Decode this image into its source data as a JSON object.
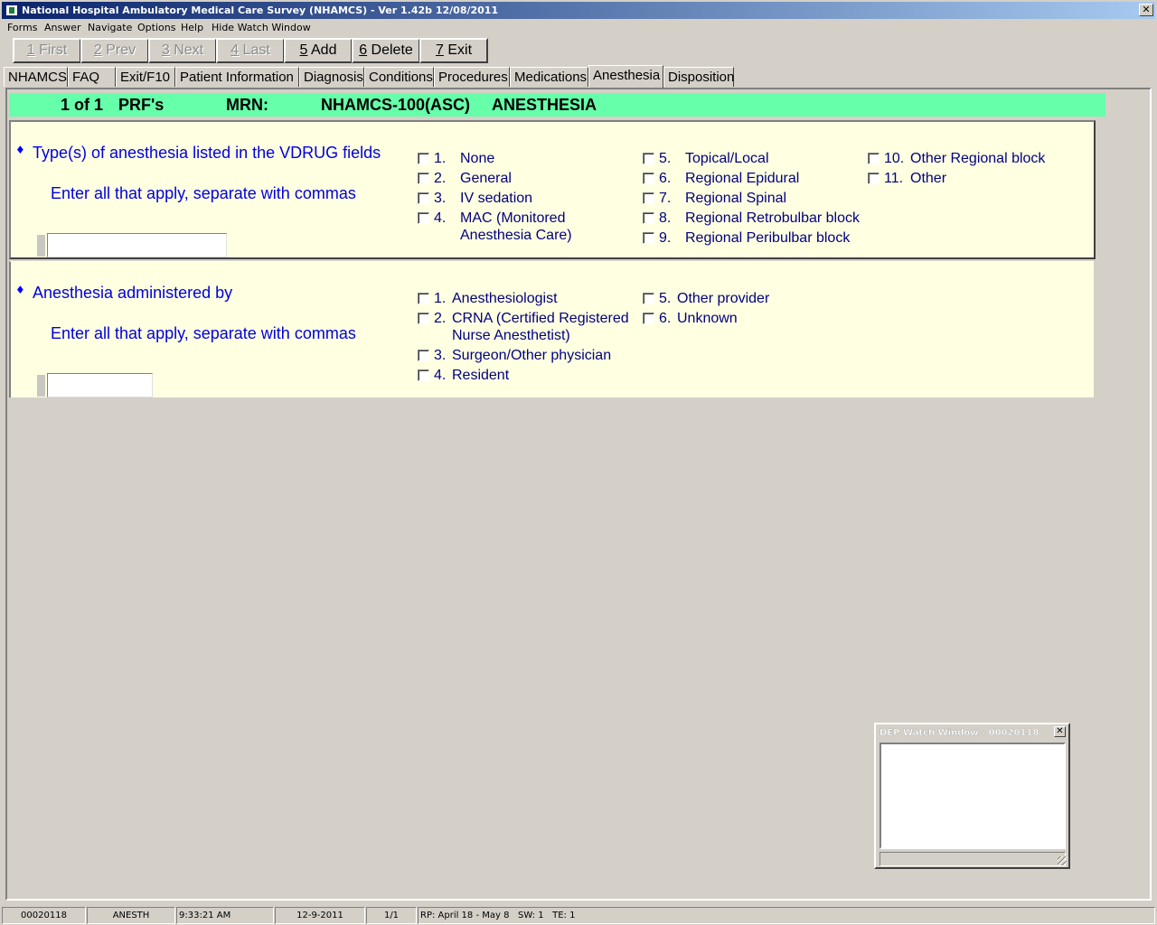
{
  "window": {
    "title": "National Hospital Ambulatory Medical Care Survey (NHAMCS) - Ver 1.42b 12/08/2011",
    "close_glyph": "✕"
  },
  "menu": [
    "Forms",
    "Answer",
    "Navigate",
    "Options",
    "Help",
    "Hide Watch Window"
  ],
  "toolbar": [
    {
      "key": "1",
      "label": " First",
      "enabled": false
    },
    {
      "key": "2",
      "label": " Prev",
      "enabled": false
    },
    {
      "key": "3",
      "label": " Next",
      "enabled": false
    },
    {
      "key": "4",
      "label": " Last",
      "enabled": false
    },
    {
      "key": "5",
      "label": " Add",
      "enabled": true
    },
    {
      "key": "6",
      "label": " Delete",
      "enabled": true
    },
    {
      "key": "7",
      "label": " Exit",
      "enabled": true
    }
  ],
  "tabs": [
    "NHAMCS",
    "FAQ",
    "Exit/F10",
    "Patient Information",
    "Diagnosis",
    "Conditions",
    "Procedures",
    "Medications",
    "Anesthesia",
    "Disposition"
  ],
  "active_tab": "Anesthesia",
  "header": {
    "record": "1 of 1",
    "prf": "PRF's",
    "mrn_label": "MRN:",
    "form": "NHAMCS-100(ASC)",
    "section": "ANESTHESIA",
    "color": "#66ffaa"
  },
  "question1": {
    "bullet": "♦",
    "text": "Type(s) of anesthesia listed in the VDRUG fields",
    "instruction": "Enter all that apply, separate with commas",
    "answer": "",
    "options": [
      {
        "num": "1.",
        "label": "None"
      },
      {
        "num": "2.",
        "label": "General"
      },
      {
        "num": "3.",
        "label": "IV sedation"
      },
      {
        "num": "4.",
        "label": "MAC (Monitored",
        "label2": "Anesthesia Care)"
      },
      {
        "num": "5.",
        "label": "Topical/Local"
      },
      {
        "num": "6.",
        "label": "Regional Epidural"
      },
      {
        "num": "7.",
        "label": "Regional Spinal"
      },
      {
        "num": "8.",
        "label": "Regional Retrobulbar block"
      },
      {
        "num": "9.",
        "label": "Regional Peribulbar block"
      },
      {
        "num": "10.",
        "label": "Other Regional block"
      },
      {
        "num": "11.",
        "label": "Other"
      }
    ]
  },
  "question2": {
    "bullet": "♦",
    "text": "Anesthesia administered by",
    "instruction": "Enter all that apply, separate with commas",
    "answer": "",
    "options": [
      {
        "num": "1.",
        "label": "Anesthesiologist"
      },
      {
        "num": "2.",
        "label": "CRNA (Certified Registered",
        "label2": "Nurse Anesthetist)"
      },
      {
        "num": "3.",
        "label": "Surgeon/Other physician"
      },
      {
        "num": "4.",
        "label": "Resident"
      },
      {
        "num": "5.",
        "label": "Other provider"
      },
      {
        "num": "6.",
        "label": "Unknown"
      }
    ]
  },
  "watch_window": {
    "title": "DEP Watch Window - 00020118",
    "close_glyph": "✕"
  },
  "status": [
    "00020118",
    "ANESTH",
    "9:33:21 AM",
    "12-9-2011",
    "1/1",
    "RP: April 18 - May 8   SW: 1   TE: 1"
  ]
}
